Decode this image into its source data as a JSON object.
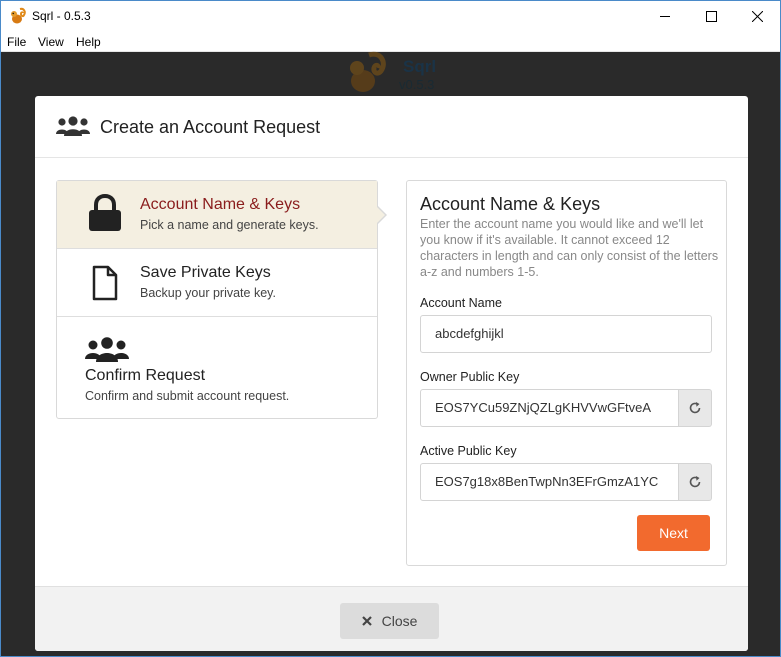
{
  "window": {
    "title": "Sqrl - 0.5.3"
  },
  "menu": {
    "file": "File",
    "view": "View",
    "help": "Help"
  },
  "background": {
    "app_name": "Sqrl",
    "version": "v0.5.3"
  },
  "modal": {
    "title": "Create an Account Request",
    "steps": [
      {
        "title": "Account Name & Keys",
        "desc": "Pick a name and generate keys.",
        "icon": "lock-icon",
        "active": true
      },
      {
        "title": "Save Private Keys",
        "desc": "Backup your private key.",
        "icon": "file-icon",
        "active": false
      },
      {
        "title": "Confirm Request",
        "desc": "Confirm and submit account request.",
        "icon": "users-icon",
        "active": false
      }
    ],
    "form": {
      "title": "Account Name & Keys",
      "description": "Enter the account name you would like and we'll let you know if it's available. It cannot exceed 12 characters in length and can only consist of the letters a-z and numbers 1-5.",
      "account_name_label": "Account Name",
      "account_name_value": "abcdefghijkl",
      "owner_key_label": "Owner Public Key",
      "owner_key_value": "EOS7YCu59ZNjQZLgKHVVwGFtveA",
      "active_key_label": "Active Public Key",
      "active_key_value": "EOS7g18x8BenTwpNn3EFrGmzA1YC",
      "next_label": "Next"
    },
    "footer": {
      "close_label": "Close"
    }
  },
  "colors": {
    "accent": "#f26a2e",
    "active_step_bg": "#f4efe1",
    "active_step_title": "#8a1c1c"
  }
}
